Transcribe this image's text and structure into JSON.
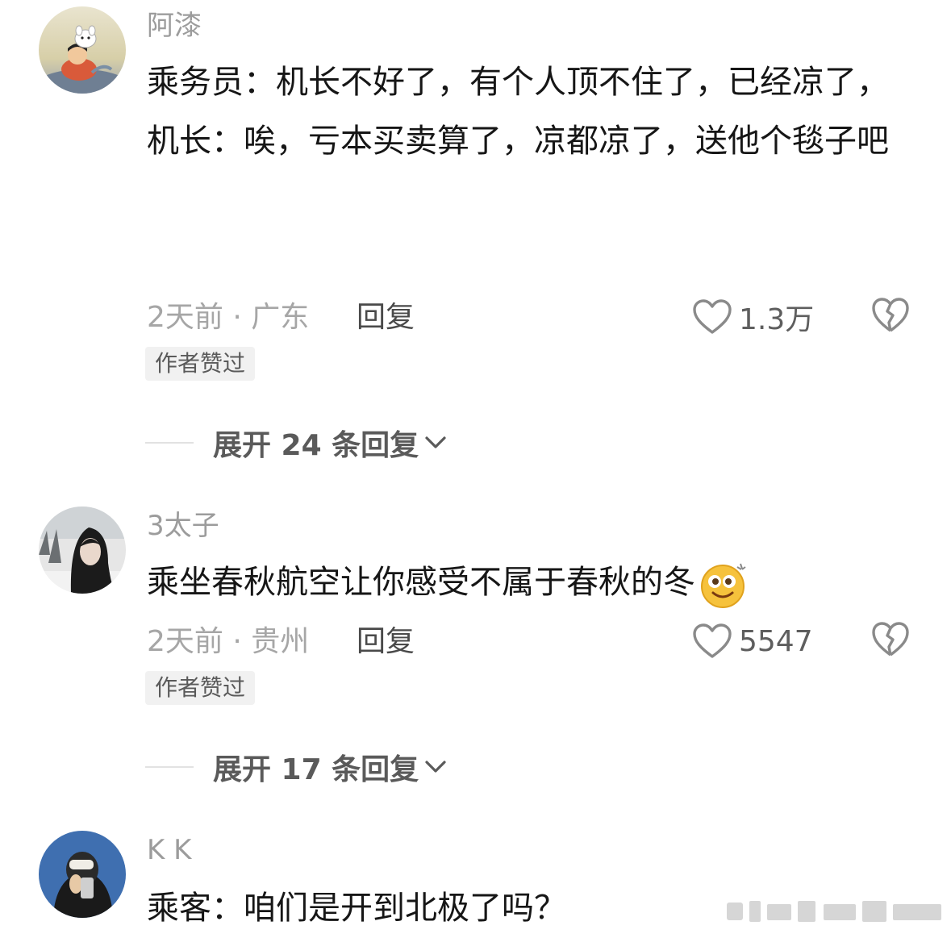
{
  "comments": [
    {
      "username": "阿漆",
      "content_lines": [
        "乘务员：机长不好了，有个人顶不住了，已经凉了，",
        "机长：唉，亏本买卖算了，凉都凉了，送他个毯子吧"
      ],
      "time_location": "2天前 · 广东",
      "reply_label": "回复",
      "like_count": "1.3万",
      "badge": "作者赞过",
      "expand_label": "展开 24 条回复"
    },
    {
      "username": "3太子",
      "content_lines": [
        "乘坐春秋航空让你感受不属于春秋的冬"
      ],
      "time_location": "2天前 · 贵州",
      "reply_label": "回复",
      "like_count": "5547",
      "badge": "作者赞过",
      "expand_label": "展开 17 条回复"
    },
    {
      "username": "K K",
      "content_lines": [
        "乘客：咱们是开到北极了吗？"
      ]
    }
  ],
  "icons": {
    "like": "heart-outline-icon",
    "dislike": "broken-heart-icon",
    "expand": "chevron-down-icon",
    "emoji": "dizzy-smile-emoji"
  },
  "colors": {
    "muted_text": "#9c9c9c",
    "body_text": "#161616",
    "badge_bg": "#f1f1f1",
    "icon_gray": "#8a8a8a"
  }
}
